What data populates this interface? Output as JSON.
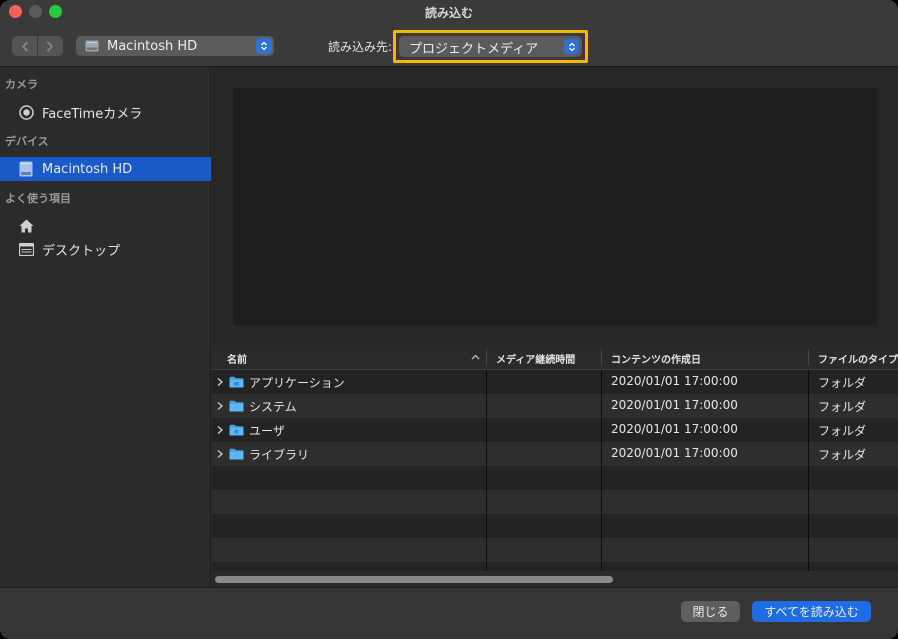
{
  "window": {
    "title": "読み込む"
  },
  "toolbar": {
    "volume_popup": {
      "label": "Macintosh HD",
      "icon": "hard-disk-icon"
    },
    "destination_label": "読み込み先:",
    "destination_popup": {
      "label": "プロジェクトメディア"
    },
    "highlight_color": "#f5b800",
    "accent_color": "#2f6fd6"
  },
  "sidebar": {
    "sections": [
      {
        "header": "カメラ",
        "items": [
          {
            "label": "FaceTimeカメラ",
            "icon": "camera-icon"
          }
        ]
      },
      {
        "header": "デバイス",
        "items": [
          {
            "label": "Macintosh HD",
            "icon": "hard-disk-icon",
            "selected": true
          }
        ]
      },
      {
        "header": "よく使う項目",
        "items": [
          {
            "label": "",
            "icon": "home-icon"
          },
          {
            "label": "デスクトップ",
            "icon": "desktop-icon"
          }
        ]
      }
    ],
    "selection_color": "#1b59c8"
  },
  "table": {
    "columns": [
      "名前",
      "メディア継続時間",
      "コンテンツの作成日",
      "ファイルのタイプ"
    ],
    "rows": [
      {
        "name": "アプリケーション",
        "duration": "",
        "created": "2020/01/01 17:00:00",
        "type": "フォルダ",
        "icon": "folder-icon"
      },
      {
        "name": "システム",
        "duration": "",
        "created": "2020/01/01 17:00:00",
        "type": "フォルダ",
        "icon": "folder-icon"
      },
      {
        "name": "ユーザ",
        "duration": "",
        "created": "2020/01/01 17:00:00",
        "type": "フォルダ",
        "icon": "folder-icon"
      },
      {
        "name": "ライブラリ",
        "duration": "",
        "created": "2020/01/01 17:00:00",
        "type": "フォルダ",
        "icon": "folder-icon"
      }
    ]
  },
  "buttons": {
    "close": "閉じる",
    "import_all": "すべてを読み込む",
    "primary_color": "#1f6ce3"
  }
}
